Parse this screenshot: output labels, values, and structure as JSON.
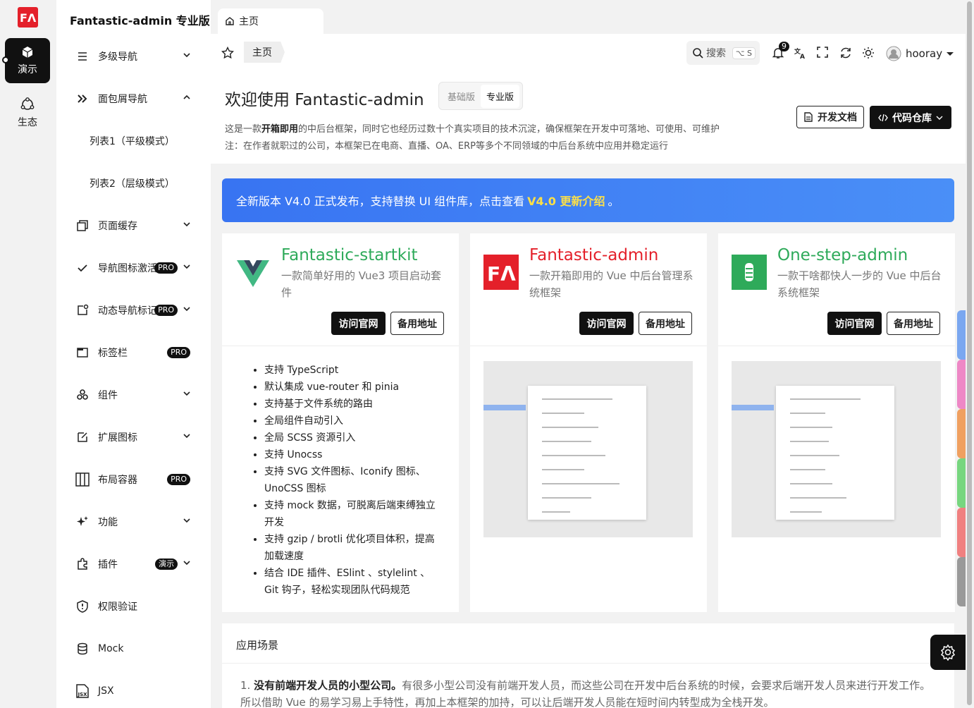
{
  "app": {
    "logo_text": "FΛ"
  },
  "main_nav": [
    {
      "label": "演示",
      "icon": "cube-icon",
      "active": true
    },
    {
      "label": "生态",
      "icon": "ecosystem-icon",
      "active": false
    }
  ],
  "sub_nav": {
    "title": "Fantastic-admin 专业版",
    "items": [
      {
        "label": "多级导航",
        "icon": "menu-lines-icon",
        "arrow": "down"
      },
      {
        "label": "面包屑导航",
        "icon": "double-chevron-icon",
        "arrow": "up"
      },
      {
        "label": "列表1（平级模式）",
        "sub": true
      },
      {
        "label": "列表2（层级模式）",
        "sub": true
      },
      {
        "label": "页面缓存",
        "icon": "copy-icon",
        "arrow": "down"
      },
      {
        "label": "导航图标激活",
        "icon": "check-icon",
        "arrow": "down",
        "badge": "PRO"
      },
      {
        "label": "动态导航标记",
        "icon": "badge-square-icon",
        "arrow": "down",
        "badge": "PRO"
      },
      {
        "label": "标签栏",
        "icon": "window-icon",
        "badge": "PRO"
      },
      {
        "label": "组件",
        "icon": "shapes-icon",
        "arrow": "down"
      },
      {
        "label": "扩展图标",
        "icon": "icon-extend-icon",
        "arrow": "down"
      },
      {
        "label": "布局容器",
        "icon": "columns-icon",
        "badge": "PRO"
      },
      {
        "label": "功能",
        "icon": "sparkle-icon",
        "arrow": "down"
      },
      {
        "label": "插件",
        "icon": "puzzle-icon",
        "arrow": "down",
        "badge": "演示"
      },
      {
        "label": "权限验证",
        "icon": "shield-icon"
      },
      {
        "label": "Mock",
        "icon": "database-icon"
      },
      {
        "label": "JSX",
        "icon": "jsx-file-icon"
      }
    ]
  },
  "tabs": [
    {
      "label": "主页",
      "icon": "home-icon"
    }
  ],
  "toolbar": {
    "breadcrumb": "主页",
    "search_label": "搜索",
    "search_shortcut": "⌥ S",
    "notification_count": "9",
    "username": "hooray"
  },
  "header": {
    "title": "欢迎使用 Fantastic-admin",
    "versions": [
      "基础版",
      "专业版"
    ],
    "active_version": "专业版",
    "desc_line1_prefix": "这是一款",
    "desc_line1_bold": "开箱即用",
    "desc_line1_suffix": "的中后台框架，同时它也经历过数十个真实项目的技术沉淀，确保框架在开发中可落地、可使用、可维护",
    "desc_line2": "注：在作者就职过的公司，本框架已在电商、直播、OA、ERP等多个不同领域的中后台系统中应用并稳定运行",
    "doc_button": "开发文档",
    "repo_button": "代码仓库"
  },
  "banner": {
    "text_before": "全新版本 V4.0 正式发布，支持替换 UI 组件库，点击查看",
    "highlight": "V4.0 更新介绍",
    "text_after": "。"
  },
  "cards": [
    {
      "name": "Fantastic-startkit",
      "desc": "一款简单好用的 Vue3 项目启动套件",
      "visit": "访问官网",
      "backup": "备用地址",
      "color": "#2eaa5a",
      "features": [
        "支持 TypeScript",
        "默认集成 vue-router 和 pinia",
        "支持基于文件系统的路由",
        "全局组件自动引入",
        "全局 SCSS 资源引入",
        "支持 Unocss",
        "支持 SVG 文件图标、Iconify 图标、UnoCSS 图标",
        "支持 mock 数据，可脱离后端束缚独立开发",
        "支持 gzip / brotli 优化项目体积，提高加载速度",
        "结合 IDE 插件、ESlint 、stylelint 、Git 钩子，轻松实现团队代码规范"
      ]
    },
    {
      "name": "Fantastic-admin",
      "desc": "一款开箱即用的 Vue 中后台管理系统框架",
      "visit": "访问官网",
      "backup": "备用地址",
      "color": "#e4202a"
    },
    {
      "name": "One-step-admin",
      "desc": "一款干啥都快人一步的 Vue 中后台系统框架",
      "visit": "访问官网",
      "backup": "备用地址",
      "color": "#2eaa5a"
    }
  ],
  "scenario": {
    "title": "应用场景",
    "item1_index": "1.",
    "item1_bold": "没有前端开发人员的小型公司。",
    "item1_text": "有很多小型公司没有前端开发人员，而这些公司在开发中后台系统的时候，会要求后端开发人员来进行开发工作。所以借助 Vue 的易学习易上手特性，再加上本框架的加持，可以让后端开发人员能在短时间内转型成为全栈开发。"
  },
  "theme_swatches": [
    "#7aa7f0",
    "#ee88c6",
    "#f0a060",
    "#77d67f",
    "#f08080",
    "#999999"
  ]
}
